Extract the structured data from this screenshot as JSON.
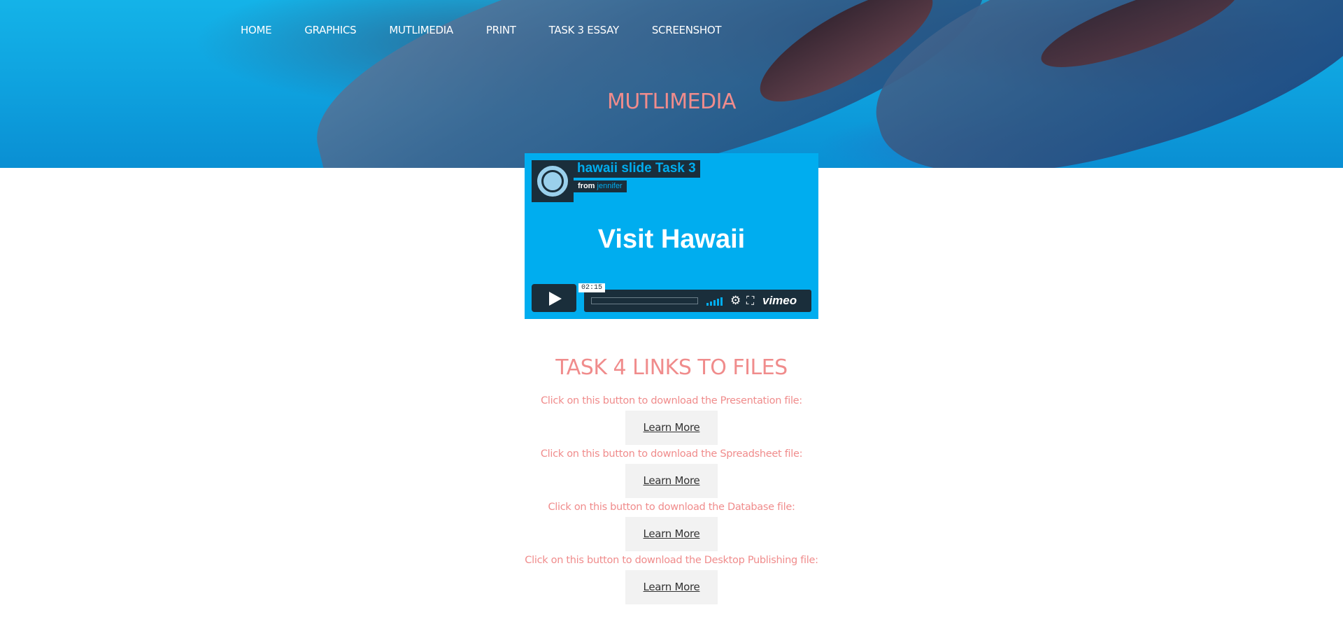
{
  "nav": {
    "items": [
      "HOME",
      "GRAPHICS",
      "MUTLIMEDIA",
      "PRINT",
      "TASK 3 ESSAY",
      "SCREENSHOT"
    ]
  },
  "hero": {
    "title": "MUTLIMEDIA"
  },
  "video": {
    "title": "hawaii slide Task 3",
    "from_label": "from",
    "author": "jennifer",
    "slide_text": "Visit Hawaii",
    "timecode": "02:15",
    "logo": "vimeo",
    "icons": [
      "play-icon",
      "volume-icon",
      "settings-gear-icon",
      "fullscreen-icon"
    ]
  },
  "section": {
    "title": "TASK 4 LINKS TO FILES"
  },
  "links": [
    {
      "caption": "Click on this button to download the Presentation file:",
      "button": "Learn More"
    },
    {
      "caption": "Click on this button to download the Spreadsheet file:",
      "button": "Learn More"
    },
    {
      "caption": "Click on this button to download the Database file:",
      "button": "Learn More"
    },
    {
      "caption": "Click on this button to download the Desktop Publishing file:",
      "button": "Learn More"
    }
  ],
  "colors": {
    "accent": "#f08c8c",
    "video_bg": "#00adef",
    "video_dark": "#1a2e3b",
    "button_bg": "#f2f2f2"
  }
}
